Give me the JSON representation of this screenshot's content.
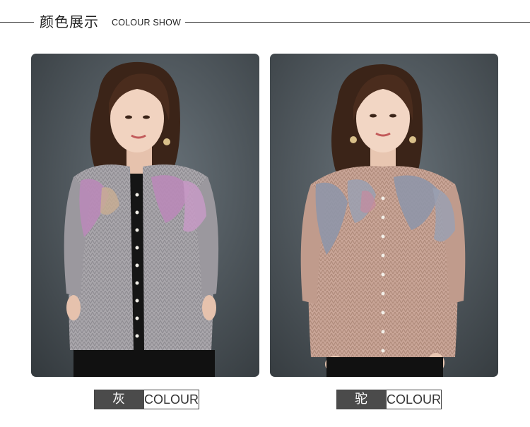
{
  "header": {
    "title_zh": "颜色展示",
    "title_en": "COLOUR SHOW"
  },
  "products": [
    {
      "color_name_zh": "灰色",
      "color_name_display": "灰 色",
      "label_en": "COLOUR",
      "cardigan_color": "#a6a3a8",
      "pattern_color": "#b98ab8"
    },
    {
      "color_name_zh": "驼色",
      "color_name_display": "驼 色",
      "label_en": "COLOUR",
      "cardigan_color": "#c9a597",
      "pattern_color": "#8f96a8"
    }
  ],
  "colors": {
    "photo_background": "#4a5257",
    "label_dark": "#4b4b4b",
    "line": "#333333"
  }
}
